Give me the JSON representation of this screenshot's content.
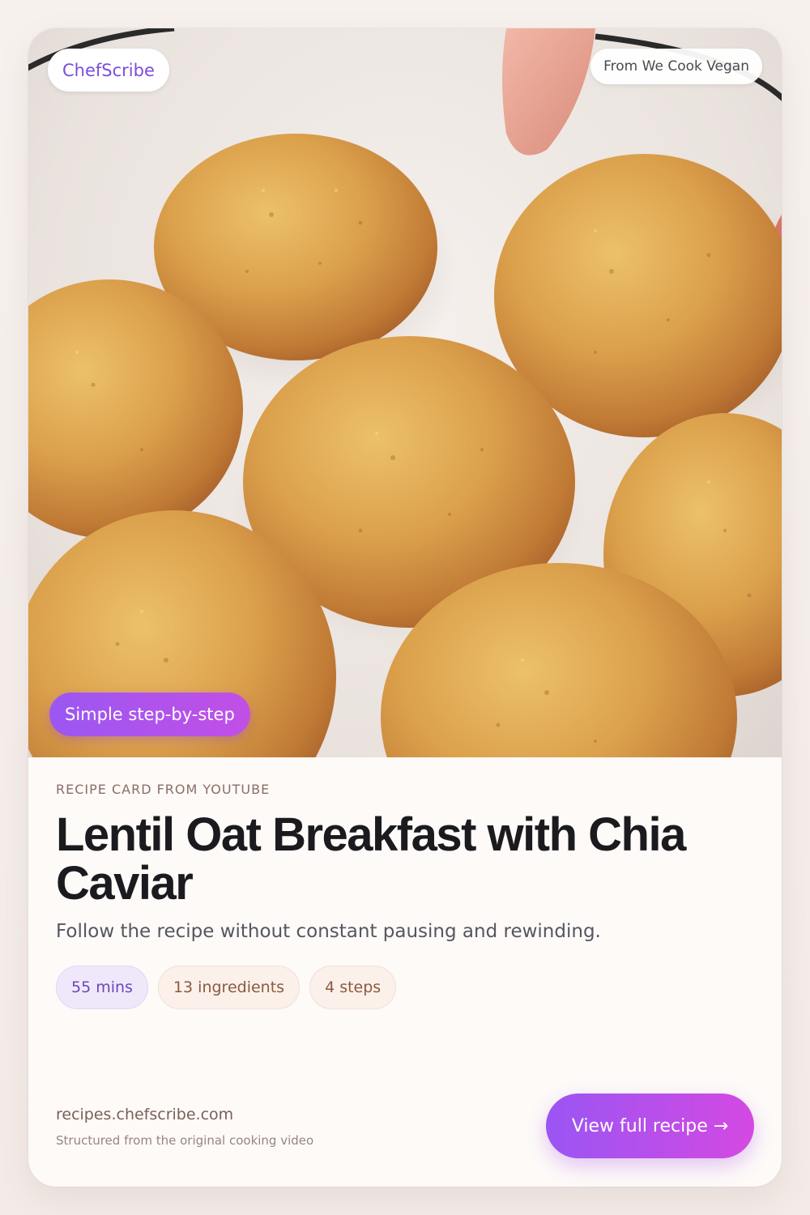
{
  "brand": {
    "name": "ChefScribe"
  },
  "source": {
    "label": "From We Cook Vegan"
  },
  "hero": {
    "badge": "Simple step-by-step"
  },
  "recipe": {
    "eyebrow": "RECIPE CARD FROM YOUTUBE",
    "title": "Lentil Oat Breakfast with Chia Caviar",
    "subtitle": "Follow the recipe without constant pausing and rewinding.",
    "meta": {
      "time": "55 mins",
      "ingredients": "13 ingredients",
      "steps": "4 steps"
    }
  },
  "footer": {
    "url": "recipes.chefscribe.com",
    "note": "Structured from the original cooking video",
    "cta": "View full recipe →"
  },
  "colors": {
    "accent_start": "#9a55f3",
    "accent_end": "#d449e2",
    "brand_text": "#7c4ddb",
    "card_background": "#fdfaf8"
  }
}
